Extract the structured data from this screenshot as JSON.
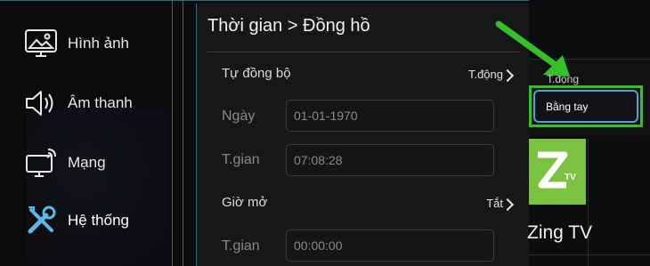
{
  "menu": {
    "items": [
      {
        "label": "Hình ảnh",
        "icon": "picture-monitor-icon"
      },
      {
        "label": "Âm thanh",
        "icon": "speaker-icon"
      },
      {
        "label": "Mạng",
        "icon": "network-monitor-icon"
      },
      {
        "label": "Hệ thống",
        "icon": "tools-icon",
        "active": true
      }
    ]
  },
  "panel": {
    "title": "Thời gian > Đồng hồ",
    "auto_sync_label": "Tự đồng bộ",
    "auto_sync_value": "T.động",
    "date_label": "Ngày",
    "date_value": "01-01-1970",
    "time_label": "T.gian",
    "time_value": "07:08:28",
    "power_on_label": "Giờ mở",
    "power_on_value": "Tắt",
    "power_on_time_label": "T.gian",
    "power_on_time_value": "00:00:00"
  },
  "dropdown": {
    "options": [
      "T.động",
      "Bằng tay"
    ],
    "selected": "Bằng tay"
  },
  "app": {
    "name": "Zing TV",
    "logo_letter": "Z",
    "logo_sub": "TV"
  },
  "colors": {
    "highlight_green": "#35c02a",
    "focus_blue": "#47a8d8",
    "frame_blue": "#2f6a80",
    "app_tile_green": "#7cc242"
  }
}
